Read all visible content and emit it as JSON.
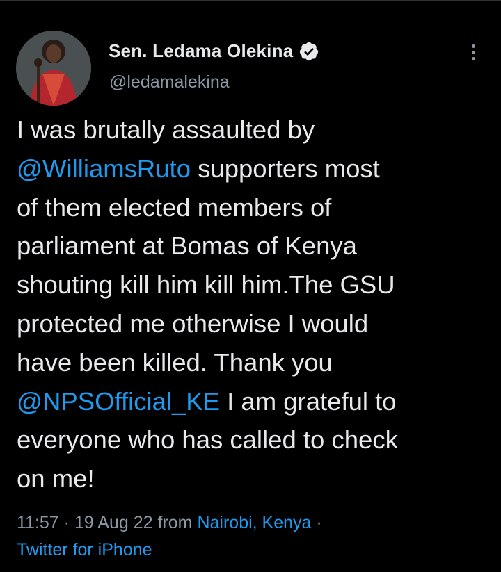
{
  "tweet": {
    "author": {
      "name": "Sen. Ledama Olekina",
      "handle": "@ledamalekina",
      "verified": true,
      "verified_color": "#e7e9ea"
    },
    "body": {
      "line1": "I was brutally assaulted by",
      "mention1": "@WilliamsRuto",
      "line2": " supporters most",
      "line3": "of them elected members of",
      "line4": "parliament at Bomas of Kenya",
      "line5": "shouting kill him kill him.The GSU",
      "line6": "protected me otherwise I would",
      "line7": "have been killed. Thank you",
      "mention2": "@NPSOfficial_KE",
      "line8": " I am grateful to",
      "line9": "everyone who has called to check",
      "line10": "on me!"
    },
    "meta": {
      "time": "11:57",
      "sep1": " · ",
      "date": "19 Aug 22",
      "from": " from ",
      "location": "Nairobi, Kenya",
      "sep2": " ·",
      "source": "Twitter for iPhone"
    }
  },
  "colors": {
    "background": "#000000",
    "text": "#e7e9ea",
    "secondary": "#8b98a5",
    "accent": "#1d9bf0"
  },
  "icons": {
    "menu": "more-vertical-icon",
    "badge": "verified-badge-icon"
  }
}
